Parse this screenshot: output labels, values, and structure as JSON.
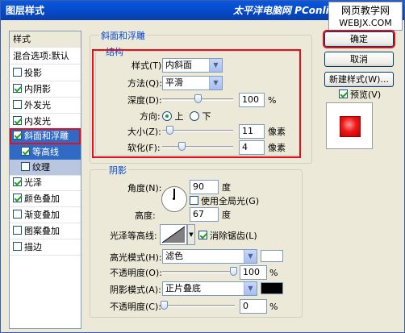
{
  "window": {
    "title": "图层样式",
    "watermark": "太平洋电脑网 PConline",
    "watermark_badge_line1": "网页教学网",
    "watermark_badge_line2": "WEBJX.COM"
  },
  "style_list": {
    "header": "样式",
    "blending": "混合选项:默认",
    "items": [
      {
        "label": "投影",
        "checked": false
      },
      {
        "label": "内阴影",
        "checked": true
      },
      {
        "label": "外发光",
        "checked": false
      },
      {
        "label": "内发光",
        "checked": true
      },
      {
        "label": "斜面和浮雕",
        "checked": true
      },
      {
        "label": "等高线",
        "checked": true
      },
      {
        "label": "纹理",
        "checked": false
      },
      {
        "label": "光泽",
        "checked": true
      },
      {
        "label": "颜色叠加",
        "checked": true
      },
      {
        "label": "渐变叠加",
        "checked": false
      },
      {
        "label": "图案叠加",
        "checked": false
      },
      {
        "label": "描边",
        "checked": false
      }
    ]
  },
  "bevel": {
    "group_title": "斜面和浮雕",
    "structure_title": "结构",
    "style_label": "样式(T):",
    "style_value": "内斜面",
    "method_label": "方法(Q):",
    "method_value": "平滑",
    "depth_label": "深度(D):",
    "depth_value": "100",
    "depth_unit": "%",
    "direction_label": "方向:",
    "direction_up": "上",
    "direction_down": "下",
    "size_label": "大小(Z):",
    "size_value": "11",
    "size_unit": "像素",
    "soften_label": "软化(F):",
    "soften_value": "4",
    "soften_unit": "像素"
  },
  "shading": {
    "group_title": "阴影",
    "angle_label": "角度(N):",
    "angle_value": "90",
    "angle_unit": "度",
    "global_light_label": "使用全局光(G)",
    "altitude_label": "高度:",
    "altitude_value": "67",
    "altitude_unit": "度",
    "gloss_label": "光泽等高线:",
    "antialias_label": "消除锯齿(L)",
    "highlight_mode_label": "高光模式(H):",
    "highlight_mode_value": "滤色",
    "highlight_color": "#ffffff",
    "highlight_opacity_label": "不透明度(O):",
    "highlight_opacity_value": "100",
    "highlight_opacity_unit": "%",
    "shadow_mode_label": "阴影模式(A):",
    "shadow_mode_value": "正片叠底",
    "shadow_color": "#000000",
    "shadow_opacity_label": "不透明度(C):",
    "shadow_opacity_value": "0",
    "shadow_opacity_unit": "%"
  },
  "buttons": {
    "ok": "确定",
    "cancel": "取消",
    "new_style": "新建样式(W)...",
    "preview_label": "预览(V)"
  }
}
